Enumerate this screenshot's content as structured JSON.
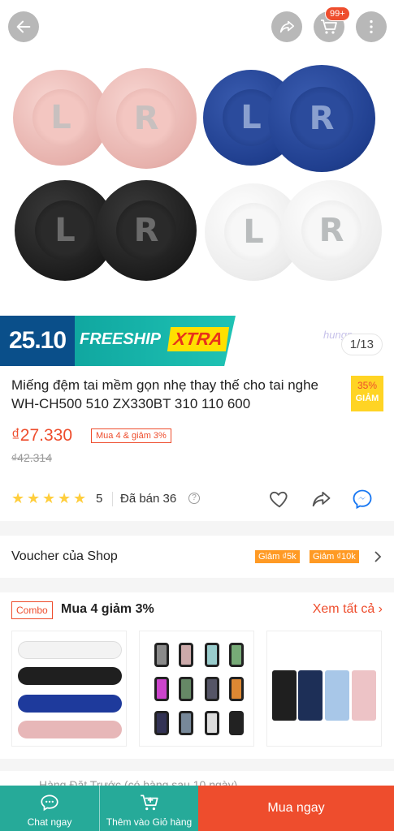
{
  "header": {
    "cart_badge": "99+",
    "icons": [
      "back-arrow-icon",
      "share-icon",
      "cart-icon",
      "more-vertical-icon"
    ]
  },
  "hero": {
    "pad_letters": {
      "left": "L",
      "right": "R"
    },
    "pad_colors": [
      "#e7b2ad",
      "#203f8f",
      "#1c1c1c",
      "#ececec"
    ]
  },
  "banner": {
    "date": "25.10",
    "freeship": "FREESHIP",
    "xtra": "XTRA",
    "watermark": "hungp...",
    "image_counter": "1/13"
  },
  "product": {
    "title": "Miếng đệm tai mềm gọn nhẹ thay thế cho tai nghe WH-CH500 510 ZX330BT 310 110 600",
    "discount_percent": "35%",
    "discount_label": "GIẢM",
    "price": "₫27.330",
    "promo_tag": "Mua 4 & giảm 3%",
    "old_price": "₫42.314",
    "rating": "5",
    "star_count": 5,
    "sold": "Đã bán 36",
    "help": "?"
  },
  "voucher": {
    "label": "Voucher của Shop",
    "tags": [
      "Giảm ₫5k",
      "Giảm ₫10k"
    ]
  },
  "combo": {
    "tag": "Combo",
    "title": "Mua 4 giảm 3%",
    "see_all": "Xem tất cả"
  },
  "preorder": {
    "text": "Hàng Đặt Trước (có hàng sau 10 ngày)"
  },
  "bottom_bar": {
    "chat": "Chat ngay",
    "add_cart": "Thêm vào Giỏ hàng",
    "buy_now": "Mua ngay"
  },
  "colors": {
    "accent": "#ee4d2d",
    "teal": "#26aa99",
    "star": "#ffce3d"
  }
}
